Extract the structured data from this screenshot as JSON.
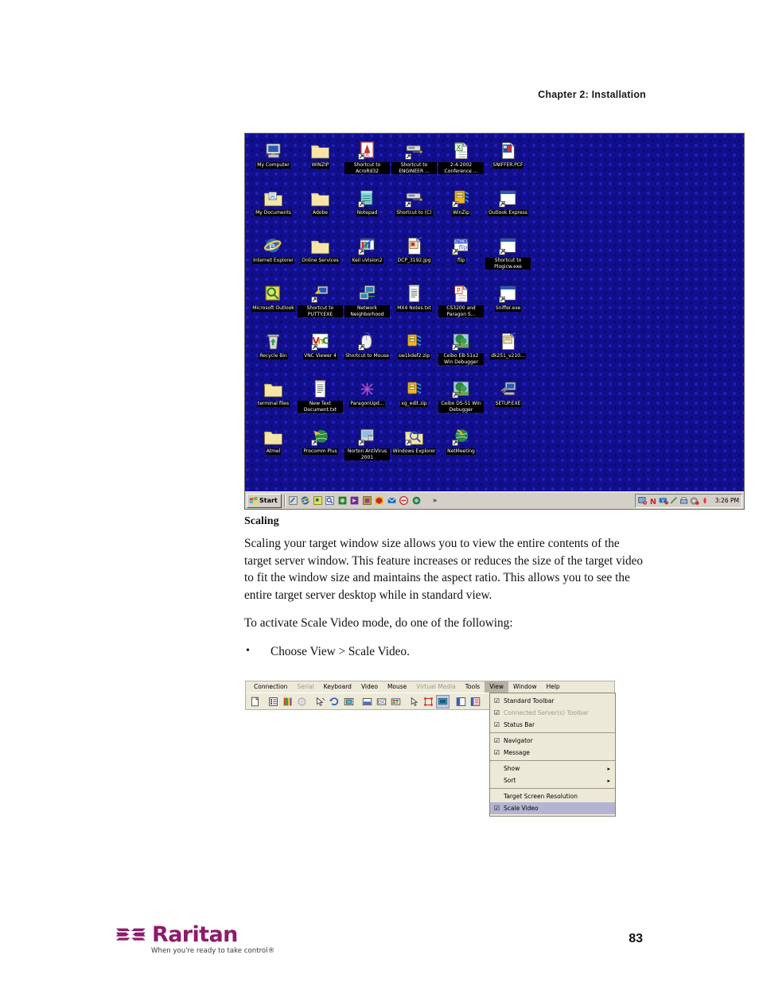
{
  "header": {
    "chapter": "Chapter 2: Installation"
  },
  "screenshot": {
    "desktop_icons": [
      {
        "label": "My Computer",
        "icon": "computer-icon"
      },
      {
        "label": "WINZIP",
        "icon": "folder-icon"
      },
      {
        "label": "Shortcut to AcroRd32",
        "icon": "acrobat-icon"
      },
      {
        "label": "Shortcut to ENGINEER ...",
        "icon": "network-drive-icon"
      },
      {
        "label": "2-4-2002 Conference ...",
        "icon": "excel-document-icon"
      },
      {
        "label": "SNIFFER.PCF",
        "icon": "sniffer-document-icon"
      },
      {
        "label": "My Documents",
        "icon": "documents-folder-icon"
      },
      {
        "label": "Adobe",
        "icon": "folder-icon"
      },
      {
        "label": "Notepad",
        "icon": "notepad-icon"
      },
      {
        "label": "Shortcut to (C)",
        "icon": "network-drive-icon"
      },
      {
        "label": "WinZip",
        "icon": "winzip-icon"
      },
      {
        "label": "Outlook Express",
        "icon": "window-icon"
      },
      {
        "label": "Internet Explorer",
        "icon": "internet-explorer-icon"
      },
      {
        "label": "Online Services",
        "icon": "folder-icon"
      },
      {
        "label": "Keil uVision2",
        "icon": "keil-uvision-icon"
      },
      {
        "label": "DCP_3192.jpg",
        "icon": "image-document-icon"
      },
      {
        "label": "flip",
        "icon": "atmel-flip-icon"
      },
      {
        "label": "Shortcut to Plogicw.exe",
        "icon": "window-icon"
      },
      {
        "label": "Microsoft Outlook",
        "icon": "outlook-icon"
      },
      {
        "label": "Shortcut to PUTTY.EXE",
        "icon": "putty-icon"
      },
      {
        "label": "Network Neighborhood",
        "icon": "network-neighborhood-icon"
      },
      {
        "label": "MX4 Notes.txt",
        "icon": "text-document-icon"
      },
      {
        "label": "CS3200 and Paragon S...",
        "icon": "powerpoint-document-icon"
      },
      {
        "label": "Sniffer.exe",
        "icon": "window-icon"
      },
      {
        "label": "Recycle Bin",
        "icon": "recycle-bin-icon"
      },
      {
        "label": "VNC Viewer 4",
        "icon": "vnc-icon"
      },
      {
        "label": "Shortcut to Mouse",
        "icon": "mouse-icon"
      },
      {
        "label": "sw1kdef2.zip",
        "icon": "zip-archive-icon"
      },
      {
        "label": "Ceibo EB-51x2 Win Debugger",
        "icon": "tree-icon"
      },
      {
        "label": "dk251_v210...",
        "icon": "notes-document-icon"
      },
      {
        "label": "terminal files",
        "icon": "folder-icon"
      },
      {
        "label": "New Text Document.txt",
        "icon": "text-document-icon"
      },
      {
        "label": "ParagonUpd...",
        "icon": "paragon-icon"
      },
      {
        "label": "xg_edit.zip",
        "icon": "zip-archive-icon"
      },
      {
        "label": "Ceibo DS-51 Win Debugger",
        "icon": "tree-icon"
      },
      {
        "label": "SETUP.EXE",
        "icon": "setup-icon"
      },
      {
        "label": "Atmel",
        "icon": "folder-icon"
      },
      {
        "label": "Procomm Plus",
        "icon": "procomm-icon"
      },
      {
        "label": "Norton AntiVirus 2001",
        "icon": "norton-icon"
      },
      {
        "label": "Windows Explorer",
        "icon": "explorer-folder-icon"
      },
      {
        "label": "NetMeeting",
        "icon": "netmeeting-icon"
      }
    ],
    "taskbar": {
      "start_label": "Start",
      "overflow_label": "»",
      "clock": "3:26 PM",
      "quick_launch": [
        "show-desktop-icon",
        "internet-explorer-icon",
        "outlook-icon",
        "search-icon",
        "acrobat-icon",
        "winamp-icon",
        "media-icon",
        "norton-icon",
        "mail-icon",
        "antivirus-icon",
        "netmeeting-icon"
      ],
      "tray_icons": [
        "scheduler-icon",
        "norton-n-icon",
        "volume-icon",
        "pencil-icon",
        "printer-icon",
        "cd-icon",
        "power-icon"
      ]
    },
    "colors": {
      "desktop_blue": "#120f8f",
      "taskbar_gray": "#d4d0c8"
    }
  },
  "content": {
    "heading": "Scaling",
    "paragraph1": "Scaling your target window size allows you to view the entire contents of the target server window. This feature increases or reduces the size of the target video to fit the window size and maintains the aspect ratio. This allows you to see the entire target server desktop while in standard view.",
    "paragraph2": "To activate Scale Video mode, do one of the following:",
    "bullets": [
      "Choose View > Scale Video."
    ]
  },
  "app": {
    "menubar": [
      {
        "label": "Connection",
        "state": "normal"
      },
      {
        "label": "Serial",
        "state": "disabled"
      },
      {
        "label": "Keyboard",
        "state": "normal"
      },
      {
        "label": "Video",
        "state": "normal"
      },
      {
        "label": "Mouse",
        "state": "normal"
      },
      {
        "label": "Virtual Media",
        "state": "disabled"
      },
      {
        "label": "Tools",
        "state": "normal"
      },
      {
        "label": "View",
        "state": "active"
      },
      {
        "label": "Window",
        "state": "normal"
      },
      {
        "label": "Help",
        "state": "normal"
      }
    ],
    "toolbar_buttons": [
      "new-connection-icon",
      "connection-properties-icon",
      "color-calibrate-icon",
      "video-refresh-icon",
      "mouse-sync-icon",
      "auto-sense-icon",
      "screen-mode-icon",
      "single-mouse-icon",
      "exit-full-screen-icon",
      "calibrate-icon",
      "cursor-icon",
      "target-icon",
      "scale-video-icon",
      "navigator-icon",
      "message-icon"
    ],
    "view_menu": [
      {
        "label": "Standard Toolbar",
        "checked": true,
        "type": "check",
        "highlighted": false,
        "disabled": false
      },
      {
        "label": "Connected Server(s) Toolbar",
        "checked": true,
        "type": "check",
        "highlighted": false,
        "disabled": true
      },
      {
        "label": "Status Bar",
        "checked": true,
        "type": "check",
        "highlighted": false,
        "disabled": false
      },
      {
        "separator": true
      },
      {
        "label": "Navigator",
        "checked": true,
        "type": "check",
        "highlighted": false,
        "disabled": false
      },
      {
        "label": "Message",
        "checked": true,
        "type": "check",
        "highlighted": false,
        "disabled": false
      },
      {
        "separator": true
      },
      {
        "label": "Show",
        "checked": false,
        "type": "submenu",
        "highlighted": false,
        "disabled": false
      },
      {
        "label": "Sort",
        "checked": false,
        "type": "submenu",
        "highlighted": false,
        "disabled": false
      },
      {
        "separator": true
      },
      {
        "label": "Target Screen Resolution",
        "checked": false,
        "type": "plain",
        "highlighted": false,
        "disabled": false
      },
      {
        "label": "Scale Video",
        "checked": true,
        "type": "check",
        "highlighted": true,
        "disabled": false
      }
    ]
  },
  "footer": {
    "brand": "Raritan",
    "tagline": "When you're ready to take control®",
    "page_number": "83",
    "brand_color": "#8d1b6a"
  }
}
